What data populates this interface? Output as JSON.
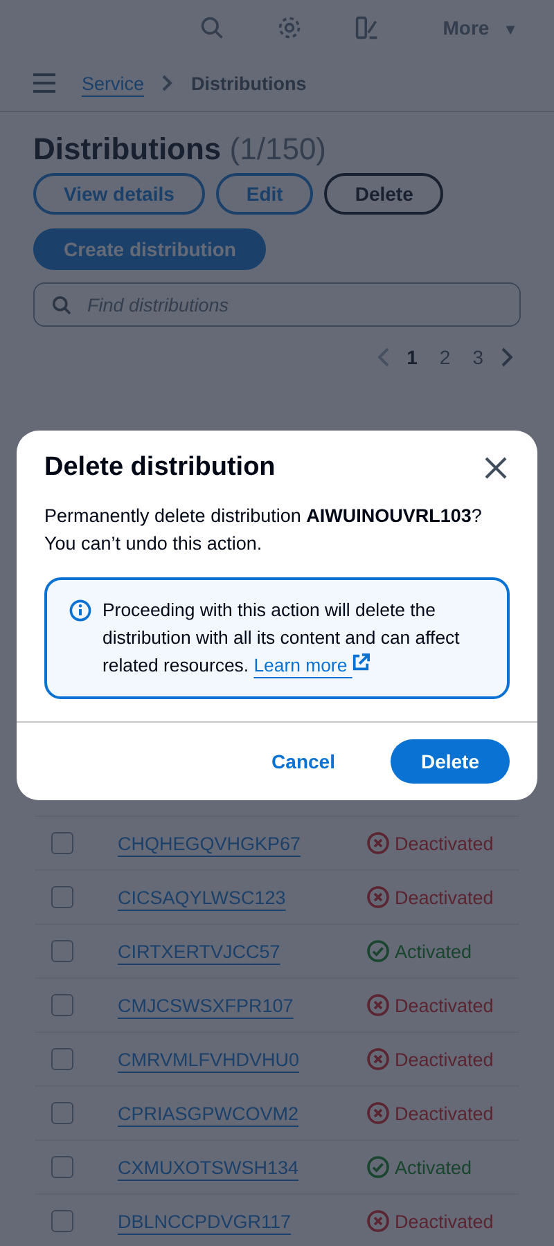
{
  "top_bar": {
    "more": {
      "label": "More",
      "caret": "▼"
    }
  },
  "breadcrumb": [
    {
      "label": "Service",
      "kind": "link"
    },
    {
      "label": "Distributions",
      "kind": "current"
    }
  ],
  "header": {
    "title": "Distributions",
    "count": "(1/150)"
  },
  "actions": [
    {
      "label": "View details",
      "kind": "normal"
    },
    {
      "label": "Edit",
      "kind": "normal"
    },
    {
      "label": "Delete",
      "kind": "normal"
    },
    {
      "label": "Create distribution",
      "kind": "primary"
    }
  ],
  "search": {
    "placeholder": "Find distributions"
  },
  "pagination": {
    "pages": [
      {
        "label": "1",
        "selected": true
      },
      {
        "label": "2",
        "selected": false
      },
      {
        "label": "3",
        "selected": false
      }
    ]
  },
  "table": {
    "rows": [
      {
        "id": "CHQHEGQVHGKP67",
        "checked": false,
        "status": {
          "kind": "deactivated",
          "label": "Deactivated"
        }
      },
      {
        "id": "CICSAQYLWSC123",
        "checked": false,
        "status": {
          "kind": "deactivated",
          "label": "Deactivated"
        }
      },
      {
        "id": "CIRTXERTVJCC57",
        "checked": false,
        "status": {
          "kind": "activated",
          "label": "Activated"
        }
      },
      {
        "id": "CMJCSWSXFPR107",
        "checked": false,
        "status": {
          "kind": "deactivated",
          "label": "Deactivated"
        }
      },
      {
        "id": "CMRVMLFVHDVHU0",
        "checked": false,
        "status": {
          "kind": "deactivated",
          "label": "Deactivated"
        }
      },
      {
        "id": "CPRIASGPWCOVM2",
        "checked": false,
        "status": {
          "kind": "deactivated",
          "label": "Deactivated"
        }
      },
      {
        "id": "CXMUXOTSWSH134",
        "checked": false,
        "status": {
          "kind": "activated",
          "label": "Activated"
        }
      },
      {
        "id": "DBLNCCPDVGR117",
        "checked": false,
        "status": {
          "kind": "deactivated",
          "label": "Deactivated"
        }
      }
    ]
  },
  "modal": {
    "title": "Delete distribution",
    "message": "Permanently delete distribution **AIWUINOUVRL103**? You can’t undo this action.",
    "alert": {
      "text": "Proceeding with this action will delete the distribution with all its content and can affect related resources.",
      "link": "Learn more"
    },
    "buttons": [
      {
        "label": "Cancel",
        "kind": "link"
      },
      {
        "label": "Delete",
        "kind": "primary"
      }
    ]
  }
}
